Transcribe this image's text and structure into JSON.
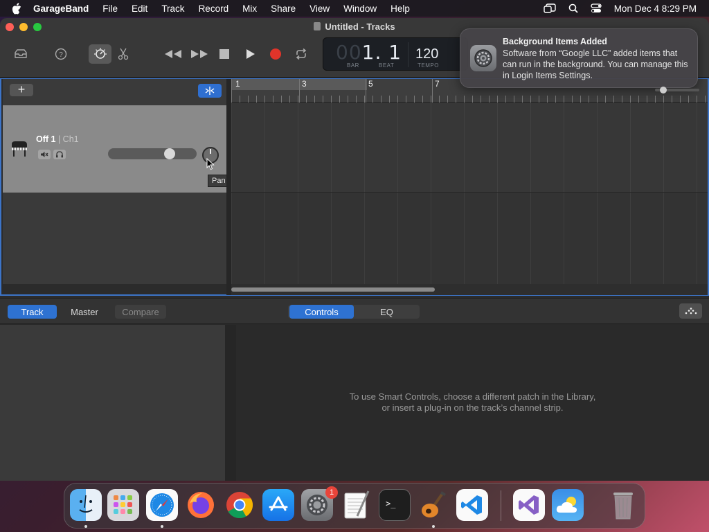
{
  "menubar": {
    "app": "GarageBand",
    "items": [
      "File",
      "Edit",
      "Track",
      "Record",
      "Mix",
      "Share",
      "View",
      "Window",
      "Help"
    ],
    "datetime": "Mon Dec 4  8:29 PM"
  },
  "window": {
    "title": "Untitled - Tracks"
  },
  "lcd": {
    "position_dim": "00",
    "position": "1. 1",
    "bar_label": "BAR",
    "beat_label": "BEAT",
    "tempo": "120",
    "tempo_label": "TEMPO"
  },
  "notification": {
    "title": "Background Items Added",
    "body": "Software from “Google LLC” added items that can run in the background. You can manage this in Login Items Settings."
  },
  "tracks": {
    "add_label": "+",
    "track_name": "Off 1",
    "track_channel": " | Ch1",
    "volume_level": 0.72,
    "pan_tooltip": "Pan",
    "ruler_numbers": [
      "1",
      "3",
      "5",
      "7"
    ]
  },
  "smart_controls": {
    "tabs_left": [
      "Track",
      "Master",
      "Compare"
    ],
    "tabs_right": [
      "Controls",
      "EQ"
    ],
    "message_line1": "To use Smart Controls, choose a different patch in the Library,",
    "message_line2": "or insert a plug-in on the track’s channel strip."
  },
  "dock": {
    "system_settings_badge": "1",
    "items": [
      "finder-icon",
      "launchpad-icon",
      "safari-icon",
      "firefox-icon",
      "chrome-icon",
      "app-store-icon",
      "system-settings-icon",
      "textedit-icon",
      "terminal-icon",
      "garageband-icon",
      "vscode-icon",
      "visual-studio-icon",
      "weather-icon",
      "trash-icon"
    ]
  },
  "colors": {
    "accent_blue": "#2e72d2",
    "record_red": "#e0342a",
    "track_row_gray": "#8a8a8a"
  }
}
